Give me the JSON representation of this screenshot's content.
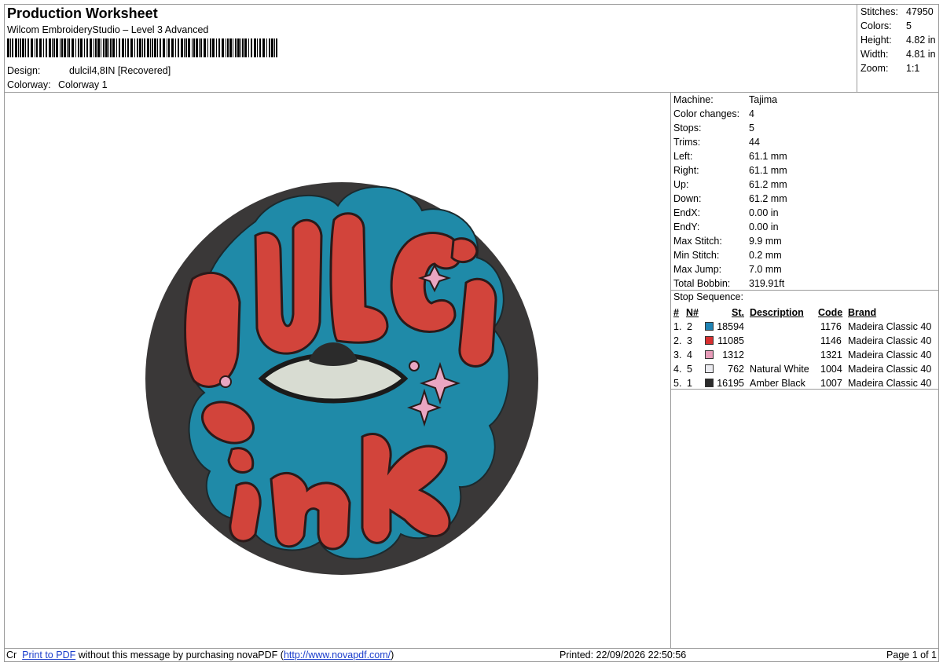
{
  "header": {
    "title": "Production Worksheet",
    "software": "Wilcom EmbroideryStudio – Level 3 Advanced",
    "design_label": "Design:",
    "design_value": "dulcil4,8IN [Recovered]",
    "colorway_label": "Colorway:",
    "colorway_value": "Colorway 1"
  },
  "summary": [
    {
      "label": "Stitches:",
      "value": "47950"
    },
    {
      "label": "Colors:",
      "value": "5"
    },
    {
      "label": "Height:",
      "value": "4.82 in"
    },
    {
      "label": "Width:",
      "value": "4.81 in"
    },
    {
      "label": "Zoom:",
      "value": "1:1"
    }
  ],
  "properties": [
    {
      "label": "Machine:",
      "value": "Tajima"
    },
    {
      "label": "Color changes:",
      "value": "4"
    },
    {
      "label": "Stops:",
      "value": "5"
    },
    {
      "label": "Trims:",
      "value": "44"
    },
    {
      "label": "Left:",
      "value": "61.1 mm"
    },
    {
      "label": "Right:",
      "value": "61.1 mm"
    },
    {
      "label": "Up:",
      "value": "61.2 mm"
    },
    {
      "label": "Down:",
      "value": "61.2 mm"
    },
    {
      "label": "EndX:",
      "value": "0.00 in"
    },
    {
      "label": "EndY:",
      "value": "0.00 in"
    },
    {
      "label": "Max Stitch:",
      "value": "9.9 mm"
    },
    {
      "label": "Min Stitch:",
      "value": "0.2 mm"
    },
    {
      "label": "Max Jump:",
      "value": "7.0 mm"
    },
    {
      "label": "Total Bobbin:",
      "value": "319.91ft"
    }
  ],
  "stop_sequence": {
    "title": "Stop Sequence:",
    "headers": {
      "num": "#",
      "n": "N#",
      "st": "St.",
      "desc": "Description",
      "code": "Code",
      "brand": "Brand"
    },
    "rows": [
      {
        "num": "1.",
        "n": "2",
        "color": "#1f83b4",
        "st": "18594",
        "desc": "",
        "code": "1176",
        "brand": "Madeira Classic 40"
      },
      {
        "num": "2.",
        "n": "3",
        "color": "#d83030",
        "st": "11085",
        "desc": "",
        "code": "1146",
        "brand": "Madeira Classic 40"
      },
      {
        "num": "3.",
        "n": "4",
        "color": "#e79cb9",
        "st": "1312",
        "desc": "",
        "code": "1321",
        "brand": "Madeira Classic 40"
      },
      {
        "num": "4.",
        "n": "5",
        "color": "#ebebf0",
        "st": "762",
        "desc": "Natural White",
        "code": "1004",
        "brand": "Madeira Classic 40"
      },
      {
        "num": "5.",
        "n": "1",
        "color": "#2a2a2a",
        "st": "16195",
        "desc": "Amber Black",
        "code": "1007",
        "brand": "Madeira Classic 40"
      }
    ]
  },
  "footer": {
    "prefix": "Cr",
    "link1": "Print to PDF",
    "text1": " without this message by purchasing novaPDF (",
    "link2": "http://www.novapdf.com/",
    "text2": ")",
    "printed": "Printed: 22/09/2026 22:50:56",
    "page": "Page 1 of 1"
  },
  "colors": {
    "black_fill": "#3a3838",
    "teal_fill": "#1f8aa8",
    "red_fill": "#d2443b",
    "pink_fill": "#e9a6c2",
    "white_fill": "#d8dcd2"
  }
}
